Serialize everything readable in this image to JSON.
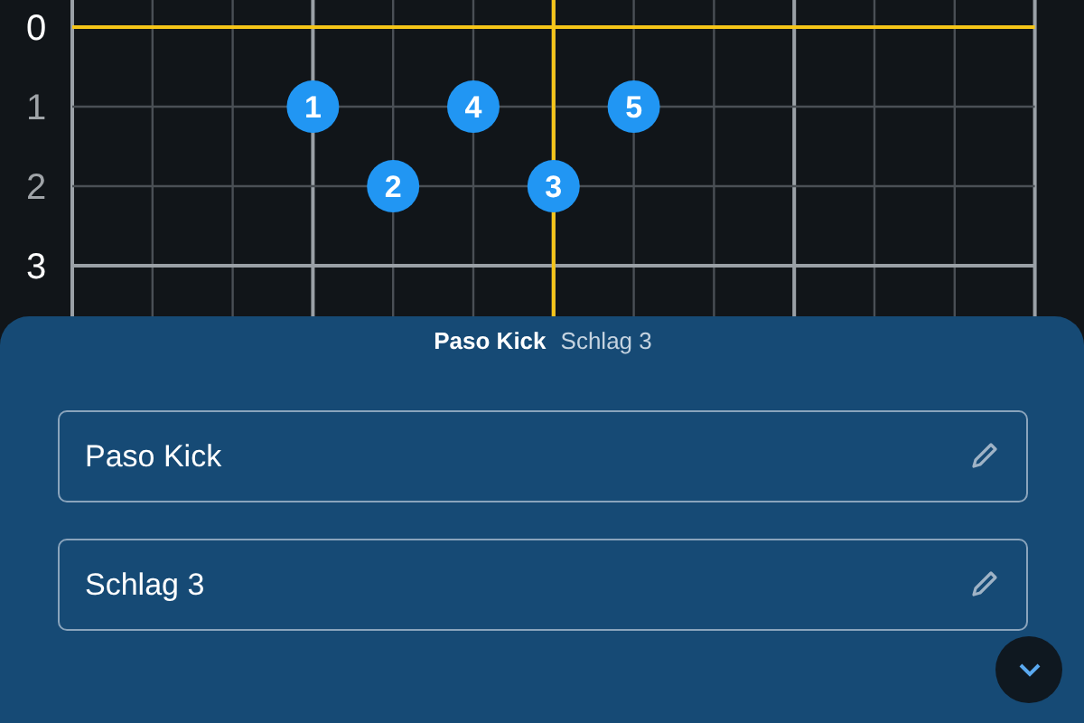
{
  "grid": {
    "row_labels": [
      {
        "text": "0",
        "major": true
      },
      {
        "text": "1",
        "major": false
      },
      {
        "text": "2",
        "major": false
      },
      {
        "text": "3",
        "major": true
      }
    ],
    "markers": [
      {
        "label": "1"
      },
      {
        "label": "2"
      },
      {
        "label": "3"
      },
      {
        "label": "4"
      },
      {
        "label": "5"
      }
    ]
  },
  "sheet": {
    "title": "Paso Kick",
    "subtitle": "Schlag 3",
    "fields": [
      {
        "value": "Paso Kick"
      },
      {
        "value": "Schlag 3"
      }
    ]
  }
}
